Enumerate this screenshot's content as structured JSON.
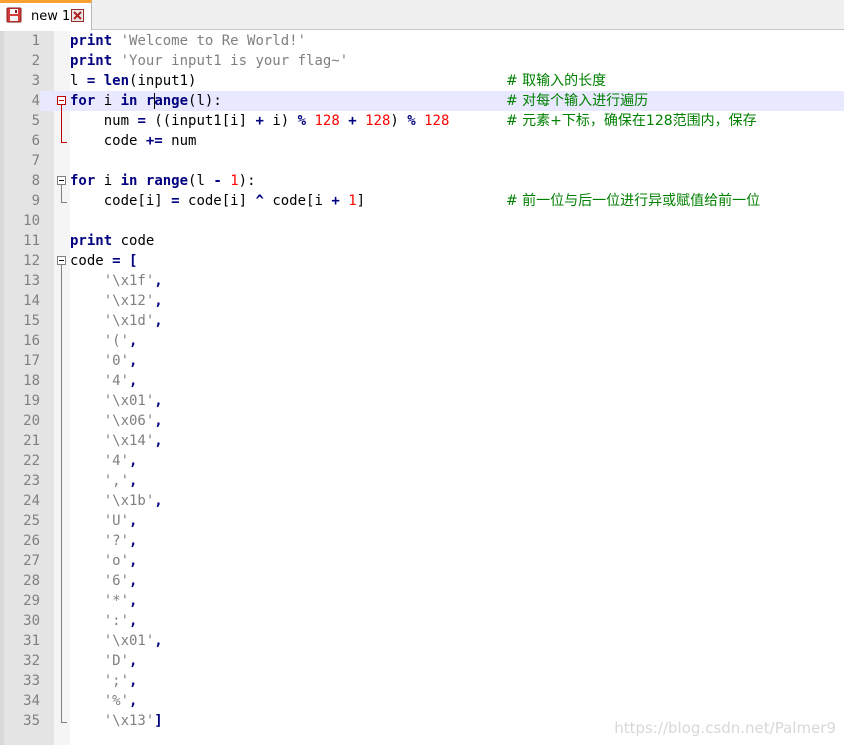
{
  "tab": {
    "label": "new 1",
    "save_icon": "floppy-disk-icon",
    "close_icon": "close-icon",
    "accent_color": "#f9a033"
  },
  "editor": {
    "current_line": 4,
    "lines": [
      {
        "n": "1",
        "tokens": [
          [
            "kw",
            "print"
          ],
          [
            "t",
            " "
          ],
          [
            "str",
            "'Welcome to Re World!'"
          ]
        ],
        "comment": ""
      },
      {
        "n": "2",
        "tokens": [
          [
            "kw",
            "print"
          ],
          [
            "t",
            " "
          ],
          [
            "str",
            "'Your input1 is your flag~'"
          ]
        ],
        "comment": ""
      },
      {
        "n": "3",
        "tokens": [
          [
            "t",
            "l "
          ],
          [
            "op",
            "="
          ],
          [
            "t",
            " "
          ],
          [
            "kw",
            "len"
          ],
          [
            "t",
            "(input1)"
          ]
        ],
        "comment": "# 取输入的长度"
      },
      {
        "n": "4",
        "tokens": [
          [
            "kw",
            "for"
          ],
          [
            "t",
            " i "
          ],
          [
            "kw",
            "in"
          ],
          [
            "t",
            " "
          ],
          [
            "kw",
            "range"
          ],
          [
            "t",
            "(l):"
          ]
        ],
        "comment": "# 对每个输入进行遍历"
      },
      {
        "n": "5",
        "tokens": [
          [
            "t",
            "    num "
          ],
          [
            "op",
            "="
          ],
          [
            "t",
            " ((input1[i] "
          ],
          [
            "op",
            "+"
          ],
          [
            "t",
            " i) "
          ],
          [
            "op",
            "%"
          ],
          [
            "t",
            " "
          ],
          [
            "num",
            "128"
          ],
          [
            "t",
            " "
          ],
          [
            "op",
            "+"
          ],
          [
            "t",
            " "
          ],
          [
            "num",
            "128"
          ],
          [
            "t",
            ") "
          ],
          [
            "op",
            "%"
          ],
          [
            "t",
            " "
          ],
          [
            "num",
            "128"
          ]
        ],
        "comment": "# 元素+下标，确保在128范围内，保存"
      },
      {
        "n": "6",
        "tokens": [
          [
            "t",
            "    code "
          ],
          [
            "op",
            "+="
          ],
          [
            "t",
            " num"
          ]
        ],
        "comment": ""
      },
      {
        "n": "7",
        "tokens": [],
        "comment": ""
      },
      {
        "n": "8",
        "tokens": [
          [
            "kw",
            "for"
          ],
          [
            "t",
            " i "
          ],
          [
            "kw",
            "in"
          ],
          [
            "t",
            " "
          ],
          [
            "kw",
            "range"
          ],
          [
            "t",
            "(l "
          ],
          [
            "op",
            "-"
          ],
          [
            "t",
            " "
          ],
          [
            "num",
            "1"
          ],
          [
            "t",
            "):"
          ]
        ],
        "comment": ""
      },
      {
        "n": "9",
        "tokens": [
          [
            "t",
            "    code[i] "
          ],
          [
            "op",
            "="
          ],
          [
            "t",
            " code[i] "
          ],
          [
            "op",
            "^"
          ],
          [
            "t",
            " code[i "
          ],
          [
            "op",
            "+"
          ],
          [
            "t",
            " "
          ],
          [
            "num",
            "1"
          ],
          [
            "t",
            "]"
          ]
        ],
        "comment": "# 前一位与后一位进行异或赋值给前一位"
      },
      {
        "n": "10",
        "tokens": [],
        "comment": ""
      },
      {
        "n": "11",
        "tokens": [
          [
            "kw",
            "print"
          ],
          [
            "t",
            " code"
          ]
        ],
        "comment": ""
      },
      {
        "n": "12",
        "tokens": [
          [
            "t",
            "code "
          ],
          [
            "op",
            "="
          ],
          [
            "t",
            " "
          ],
          [
            "op",
            "["
          ]
        ],
        "comment": ""
      },
      {
        "n": "13",
        "tokens": [
          [
            "t",
            "    "
          ],
          [
            "str",
            "'\\x1f'"
          ],
          [
            "op",
            ","
          ]
        ],
        "comment": ""
      },
      {
        "n": "14",
        "tokens": [
          [
            "t",
            "    "
          ],
          [
            "str",
            "'\\x12'"
          ],
          [
            "op",
            ","
          ]
        ],
        "comment": ""
      },
      {
        "n": "15",
        "tokens": [
          [
            "t",
            "    "
          ],
          [
            "str",
            "'\\x1d'"
          ],
          [
            "op",
            ","
          ]
        ],
        "comment": ""
      },
      {
        "n": "16",
        "tokens": [
          [
            "t",
            "    "
          ],
          [
            "str",
            "'('"
          ],
          [
            "op",
            ","
          ]
        ],
        "comment": ""
      },
      {
        "n": "17",
        "tokens": [
          [
            "t",
            "    "
          ],
          [
            "str",
            "'0'"
          ],
          [
            "op",
            ","
          ]
        ],
        "comment": ""
      },
      {
        "n": "18",
        "tokens": [
          [
            "t",
            "    "
          ],
          [
            "str",
            "'4'"
          ],
          [
            "op",
            ","
          ]
        ],
        "comment": ""
      },
      {
        "n": "19",
        "tokens": [
          [
            "t",
            "    "
          ],
          [
            "str",
            "'\\x01'"
          ],
          [
            "op",
            ","
          ]
        ],
        "comment": ""
      },
      {
        "n": "20",
        "tokens": [
          [
            "t",
            "    "
          ],
          [
            "str",
            "'\\x06'"
          ],
          [
            "op",
            ","
          ]
        ],
        "comment": ""
      },
      {
        "n": "21",
        "tokens": [
          [
            "t",
            "    "
          ],
          [
            "str",
            "'\\x14'"
          ],
          [
            "op",
            ","
          ]
        ],
        "comment": ""
      },
      {
        "n": "22",
        "tokens": [
          [
            "t",
            "    "
          ],
          [
            "str",
            "'4'"
          ],
          [
            "op",
            ","
          ]
        ],
        "comment": ""
      },
      {
        "n": "23",
        "tokens": [
          [
            "t",
            "    "
          ],
          [
            "str",
            "','"
          ],
          [
            "op",
            ","
          ]
        ],
        "comment": ""
      },
      {
        "n": "24",
        "tokens": [
          [
            "t",
            "    "
          ],
          [
            "str",
            "'\\x1b'"
          ],
          [
            "op",
            ","
          ]
        ],
        "comment": ""
      },
      {
        "n": "25",
        "tokens": [
          [
            "t",
            "    "
          ],
          [
            "str",
            "'U'"
          ],
          [
            "op",
            ","
          ]
        ],
        "comment": ""
      },
      {
        "n": "26",
        "tokens": [
          [
            "t",
            "    "
          ],
          [
            "str",
            "'?'"
          ],
          [
            "op",
            ","
          ]
        ],
        "comment": ""
      },
      {
        "n": "27",
        "tokens": [
          [
            "t",
            "    "
          ],
          [
            "str",
            "'o'"
          ],
          [
            "op",
            ","
          ]
        ],
        "comment": ""
      },
      {
        "n": "28",
        "tokens": [
          [
            "t",
            "    "
          ],
          [
            "str",
            "'6'"
          ],
          [
            "op",
            ","
          ]
        ],
        "comment": ""
      },
      {
        "n": "29",
        "tokens": [
          [
            "t",
            "    "
          ],
          [
            "str",
            "'*'"
          ],
          [
            "op",
            ","
          ]
        ],
        "comment": ""
      },
      {
        "n": "30",
        "tokens": [
          [
            "t",
            "    "
          ],
          [
            "str",
            "':'"
          ],
          [
            "op",
            ","
          ]
        ],
        "comment": ""
      },
      {
        "n": "31",
        "tokens": [
          [
            "t",
            "    "
          ],
          [
            "str",
            "'\\x01'"
          ],
          [
            "op",
            ","
          ]
        ],
        "comment": ""
      },
      {
        "n": "32",
        "tokens": [
          [
            "t",
            "    "
          ],
          [
            "str",
            "'D'"
          ],
          [
            "op",
            ","
          ]
        ],
        "comment": ""
      },
      {
        "n": "33",
        "tokens": [
          [
            "t",
            "    "
          ],
          [
            "str",
            "';'"
          ],
          [
            "op",
            ","
          ]
        ],
        "comment": ""
      },
      {
        "n": "34",
        "tokens": [
          [
            "t",
            "    "
          ],
          [
            "str",
            "'%'"
          ],
          [
            "op",
            ","
          ]
        ],
        "comment": ""
      },
      {
        "n": "35",
        "tokens": [
          [
            "t",
            "    "
          ],
          [
            "str",
            "'\\x13'"
          ],
          [
            "op",
            "]"
          ]
        ],
        "comment": ""
      }
    ]
  },
  "watermark": "https://blog.csdn.net/Palmer9",
  "colors": {
    "keyword": "#000080",
    "string": "#808080",
    "number": "#ff0000",
    "comment": "#008000",
    "current_line_bg": "#e8e8ff",
    "fold_marker_active": "#c00000"
  }
}
